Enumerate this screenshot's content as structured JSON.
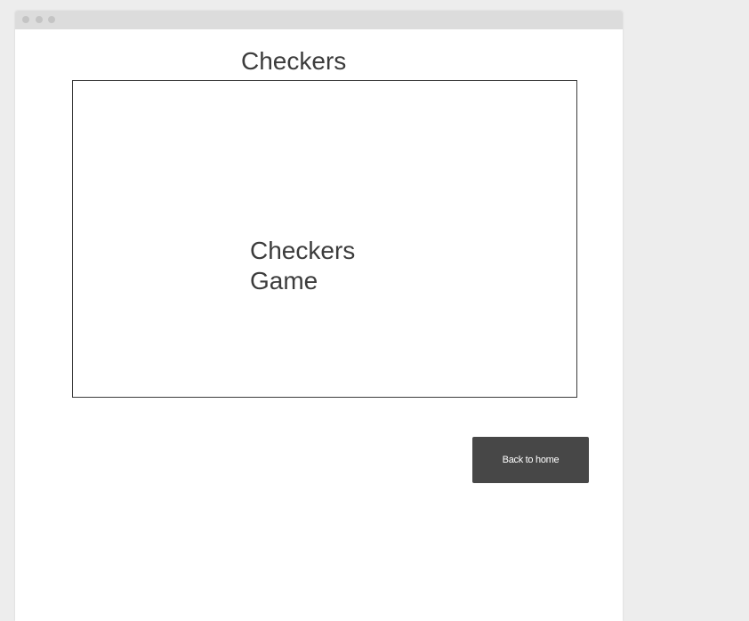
{
  "page": {
    "title": "Checkers"
  },
  "game": {
    "label_line1": "Checkers",
    "label_line2": "Game"
  },
  "actions": {
    "back_label": "Back to home"
  }
}
